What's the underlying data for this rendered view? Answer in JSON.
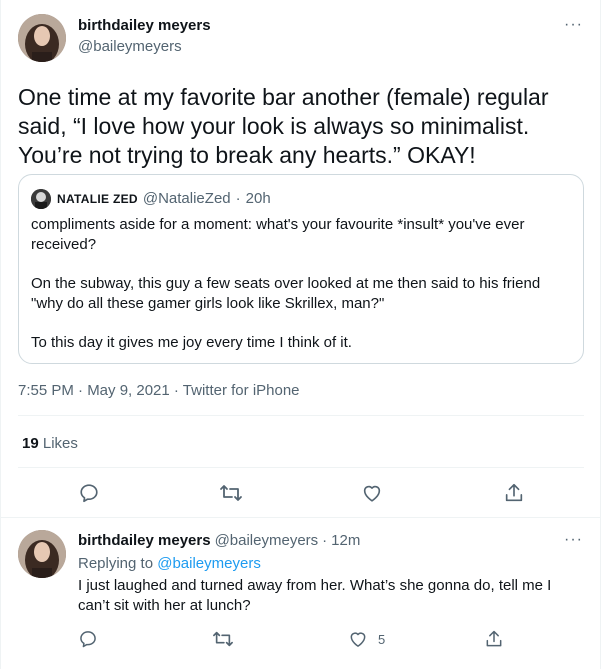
{
  "tweet": {
    "author_name": "birthdailey meyers",
    "author_handle": "@baileymeyers",
    "more_label": "···",
    "text": "One time at my favorite bar another (female) regular said, “I love how your look is always so minimalist. You’re not trying to break any hearts.” OKAY!",
    "timestamp": "7:55 PM · May 9, 2021 · Twitter for iPhone",
    "likes_count": "19",
    "likes_label": "Likes"
  },
  "quoted": {
    "author_name": "NATALIE ZED",
    "author_handle": "@NatalieZed",
    "separator": "·",
    "time": "20h",
    "paragraphs": [
      "compliments aside for a moment: what's your favourite *insult* you've ever received?",
      "On the subway, this guy a few seats over looked at me then said to his friend \"why do all these gamer girls look like Skrillex, man?\"",
      "To this day it gives me joy every time I think of it."
    ]
  },
  "reply": {
    "author_name": "birthdailey meyers",
    "author_handle": "@baileymeyers",
    "separator": "·",
    "time": "12m",
    "more_label": "···",
    "replying_prefix": "Replying to",
    "replying_to": "@baileymeyers",
    "text": "I just laughed and turned away from her. What’s she gonna do, tell me I can’t sit with her at lunch?",
    "like_count": "5"
  },
  "icons": [
    "reply-icon",
    "retweet-icon",
    "like-icon",
    "share-icon",
    "more-icon"
  ],
  "colors": {
    "link": "#1d9bf0",
    "secondary_text": "#536471",
    "border": "#cfd9de"
  }
}
